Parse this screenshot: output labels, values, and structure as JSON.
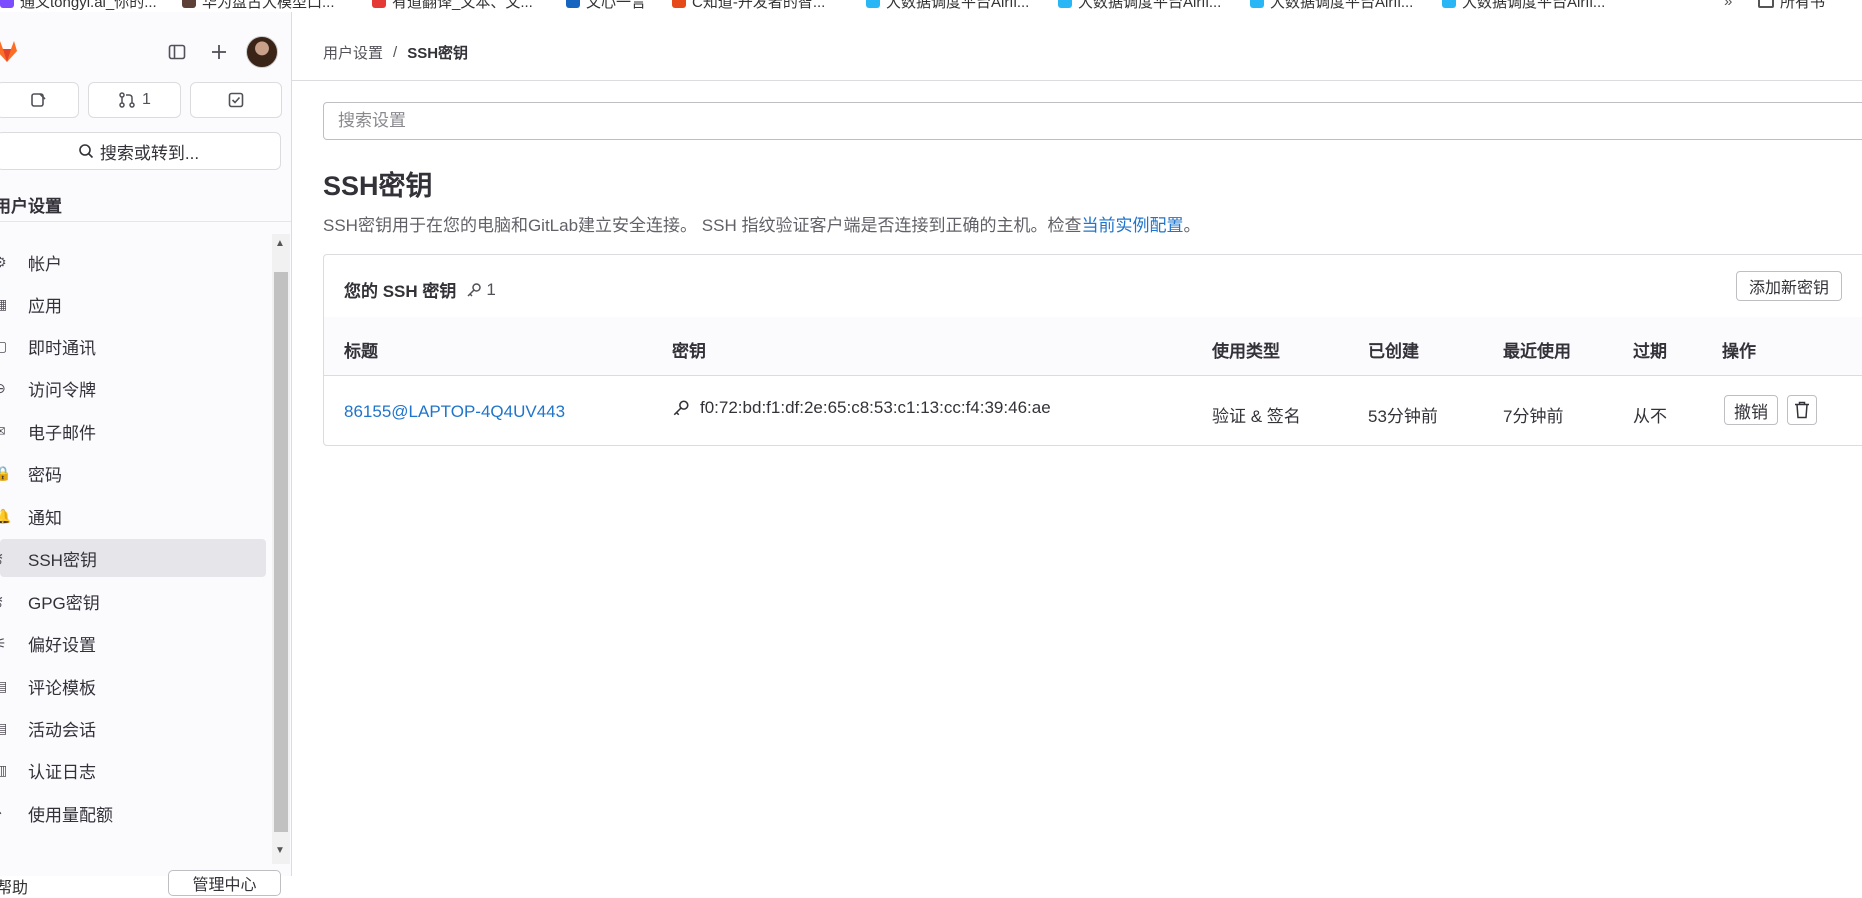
{
  "bookmarks": [
    {
      "label": "通义tongyi.ai_你的...",
      "color": "#7c4dff"
    },
    {
      "label": "华为盘古大模型口...",
      "color": "#5d4037"
    },
    {
      "label": "有道翻译_文本、文...",
      "color": "#e53935"
    },
    {
      "label": "文心一言",
      "color": "#1565c0"
    },
    {
      "label": "C知道-开发者的智...",
      "color": "#e64a19"
    },
    {
      "label": "大数据调度平台Airfl...",
      "color": "#29b6f6"
    },
    {
      "label": "大数据调度平台Airfl...",
      "color": "#29b6f6"
    },
    {
      "label": "大数据调度平台Airfl...",
      "color": "#29b6f6"
    },
    {
      "label": "大数据调度平台Airfl...",
      "color": "#29b6f6"
    }
  ],
  "bookmarks_right": "所有书",
  "sidebar": {
    "merge_requests_count": "1",
    "search_label": "搜索或转到...",
    "section_title": "用户设置",
    "items": [
      {
        "label": "帐户",
        "icon": "account-icon",
        "glyph": "⚙"
      },
      {
        "label": "应用",
        "icon": "applications-icon",
        "glyph": "▦"
      },
      {
        "label": "即时通讯",
        "icon": "chat-icon",
        "glyph": "▢"
      },
      {
        "label": "访问令牌",
        "icon": "token-icon",
        "glyph": "⊖"
      },
      {
        "label": "电子邮件",
        "icon": "mail-icon",
        "glyph": "✉"
      },
      {
        "label": "密码",
        "icon": "lock-icon",
        "glyph": "🔒"
      },
      {
        "label": "通知",
        "icon": "bell-icon",
        "glyph": "🔔"
      },
      {
        "label": "SSH密钥",
        "icon": "key-icon",
        "glyph": "⚷",
        "active": true
      },
      {
        "label": "GPG密钥",
        "icon": "key-icon",
        "glyph": "⚷"
      },
      {
        "label": "偏好设置",
        "icon": "preferences-icon",
        "glyph": "⚟"
      },
      {
        "label": "评论模板",
        "icon": "comment-icon",
        "glyph": "▤"
      },
      {
        "label": "活动会话",
        "icon": "sessions-icon",
        "glyph": "▤"
      },
      {
        "label": "认证日志",
        "icon": "log-icon",
        "glyph": "▥"
      },
      {
        "label": "使用量配额",
        "icon": "quota-icon",
        "glyph": "◔"
      }
    ],
    "help_label": "帮助",
    "admin_label": "管理中心"
  },
  "breadcrumb": {
    "parent": "用户设置",
    "current": "SSH密钥"
  },
  "search_settings": {
    "placeholder": "搜索设置"
  },
  "page": {
    "title": "SSH密钥",
    "description": "SSH密钥用于在您的电脑和GitLab建立安全连接。 SSH 指纹验证客户端是否连接到正确的主机。检查",
    "description_link": "当前实例配置",
    "description_end": "。"
  },
  "keys_card": {
    "title": "您的 SSH 密钥",
    "count": "1",
    "add_button": "添加新密钥",
    "columns": [
      "标题",
      "密钥",
      "使用类型",
      "已创建",
      "最近使用",
      "过期",
      "操作"
    ],
    "rows": [
      {
        "title": "86155@LAPTOP-4Q4UV443",
        "fingerprint": "f0:72:bd:f1:df:2e:65:c8:53:c1:13:cc:f4:39:46:ae",
        "usage": "验证 & 签名",
        "created": "53分钟前",
        "last_used": "7分钟前",
        "expires": "从不",
        "revoke_label": "撤销"
      }
    ]
  },
  "colors": {
    "link": "#1f75cb",
    "sidebar_bg": "#fbfafd",
    "active_item": "#e6e5ea",
    "logo": "#fc6d26"
  }
}
